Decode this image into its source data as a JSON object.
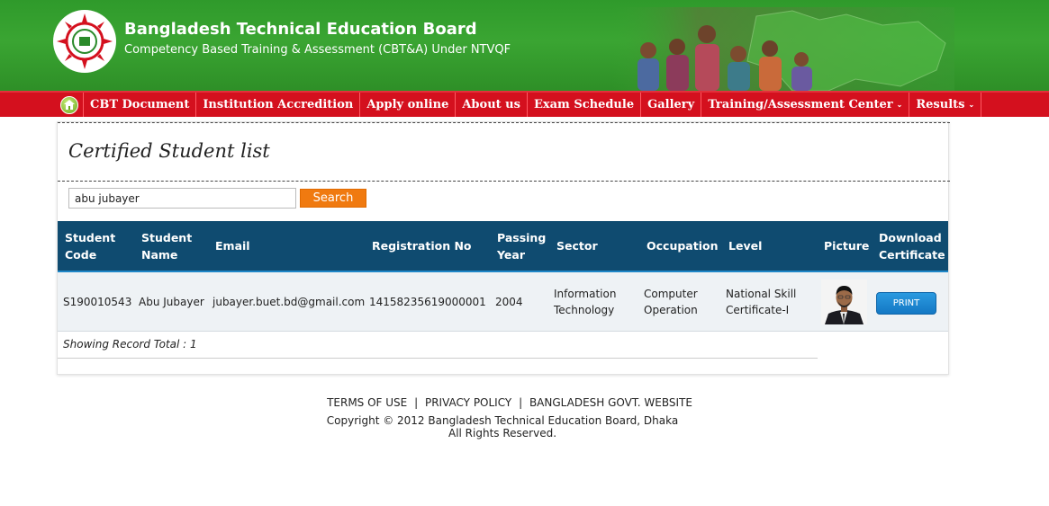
{
  "header": {
    "title": "Bangladesh Technical Education Board",
    "subtitle": "Competency Based Training & Assessment (CBT&A) Under NTVQF"
  },
  "nav": {
    "items": [
      {
        "label": "CBT Document"
      },
      {
        "label": "Institution Accredition"
      },
      {
        "label": "Apply online"
      },
      {
        "label": "About us"
      },
      {
        "label": "Exam Schedule"
      },
      {
        "label": "Gallery"
      },
      {
        "label": "Training/Assessment Center",
        "dropdown": true
      },
      {
        "label": "Results",
        "dropdown": true
      }
    ]
  },
  "page": {
    "title": "Certified Student list"
  },
  "search": {
    "value": "abu jubayer",
    "button_label": "Search"
  },
  "table": {
    "headers": {
      "student_code": [
        "Student",
        "Code"
      ],
      "student_name": [
        "Student",
        "Name"
      ],
      "email": "Email",
      "registration_no": "Registration No",
      "passing_year": [
        "Passing",
        "Year"
      ],
      "sector": "Sector",
      "occupation": "Occupation",
      "level": "Level",
      "picture": "Picture",
      "download_certificate": [
        "Download",
        "Certificate"
      ]
    },
    "rows": [
      {
        "student_code": "S190010543",
        "student_name": "Abu Jubayer",
        "email": "jubayer.buet.bd@gmail.com",
        "registration_no": "14158235619000001",
        "passing_year": "2004",
        "sector": [
          "Information",
          "Technology"
        ],
        "occupation": [
          "Computer",
          "Operation"
        ],
        "level": [
          "National Skill",
          "Certificate-I"
        ],
        "print_label": "PRINT"
      }
    ],
    "total_text": "Showing Record Total : 1"
  },
  "footer": {
    "links": [
      "TERMS OF USE",
      "PRIVACY POLICY",
      "BANGLADESH GOVT. WEBSITE"
    ],
    "separator": "|",
    "copyright": "Copyright © 2012 Bangladesh Technical Education Board, Dhaka",
    "rights": "All Rights Reserved."
  },
  "colors": {
    "header_green": "#3aa532",
    "nav_red": "#d4101e",
    "table_header": "#0f4b70",
    "search_button": "#f07a10",
    "print_button": "#1478c4"
  }
}
